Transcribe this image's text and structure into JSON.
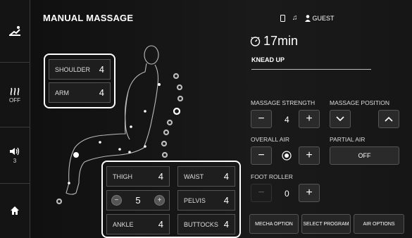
{
  "sidebar": {
    "heat": {
      "state": "OFF"
    },
    "volume": {
      "level": "3"
    }
  },
  "header": {
    "title": "MANUAL MASSAGE",
    "user_label": "GUEST",
    "timer": "17min",
    "program": "KNEAD UP"
  },
  "upper_zones": [
    {
      "label": "SHOULDER",
      "value": "4"
    },
    {
      "label": "ARM",
      "value": "4"
    }
  ],
  "lower_zones": {
    "thigh": {
      "label": "THIGH",
      "value": "4"
    },
    "waist": {
      "label": "WAIST",
      "value": "4"
    },
    "stepper": {
      "minus": "−",
      "value": "5",
      "plus": "+"
    },
    "pelvis": {
      "label": "PELVIS",
      "value": "4"
    },
    "ankle": {
      "label": "ANKLE",
      "value": "4"
    },
    "buttocks": {
      "label": "BUTTOCKS",
      "value": "4"
    }
  },
  "controls": {
    "strength": {
      "label": "MASSAGE STRENGTH",
      "value": "4",
      "minus": "−",
      "plus": "+"
    },
    "position": {
      "label": "MASSAGE POSITION"
    },
    "overall_air": {
      "label": "OVERALL AIR",
      "minus": "−",
      "plus": "+"
    },
    "partial_air": {
      "label": "PARTIAL AIR",
      "state": "OFF"
    },
    "foot_roller": {
      "label": "FOOT ROLLER",
      "value": "0",
      "minus": "−",
      "plus": "+"
    }
  },
  "bottom_buttons": [
    "MECHA OPTION",
    "SELECT PROGRAM",
    "AIR OPTIONS"
  ]
}
